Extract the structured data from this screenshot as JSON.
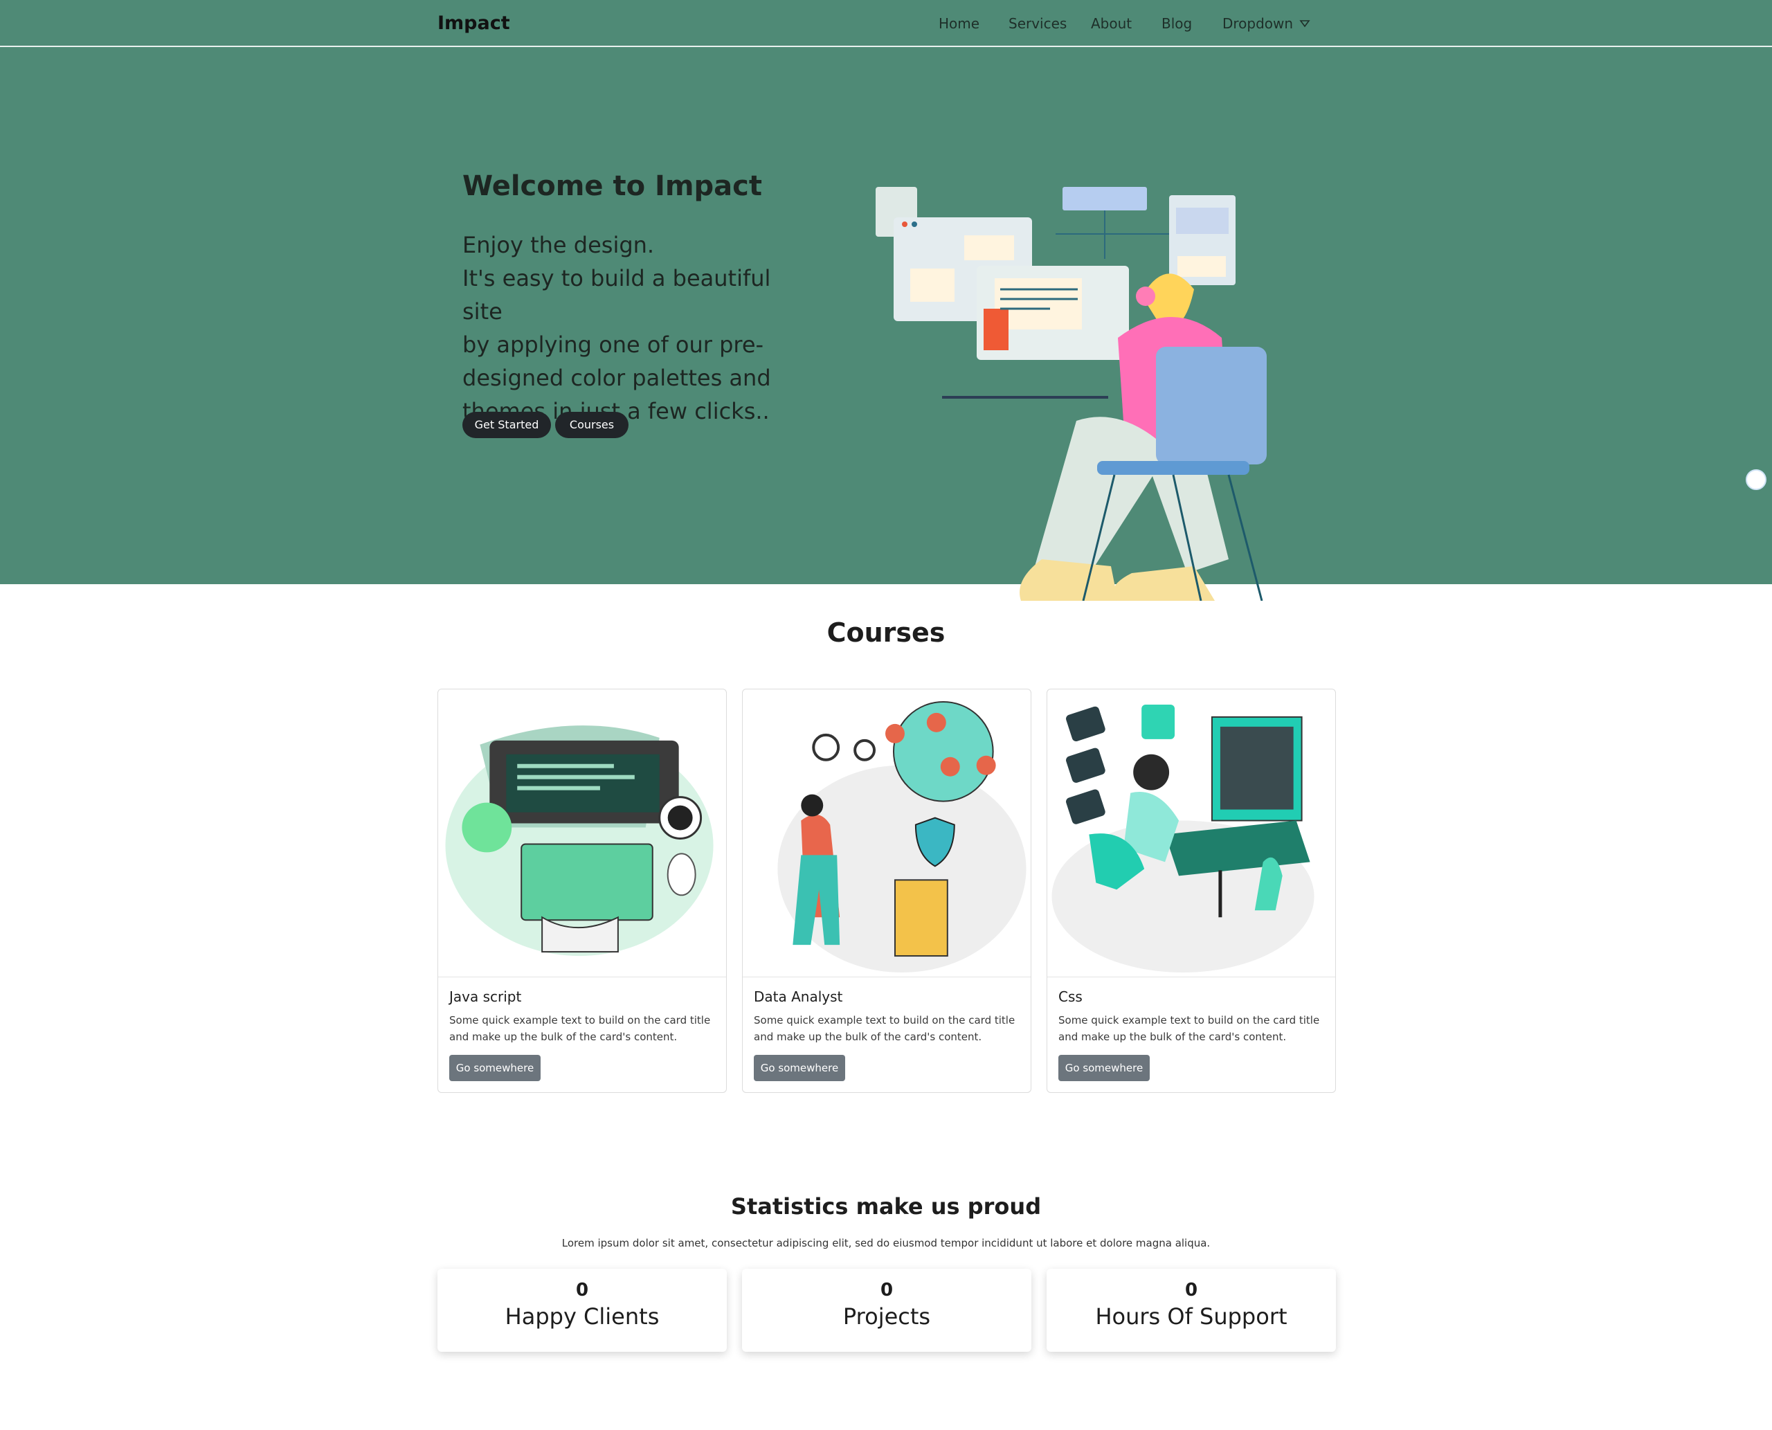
{
  "nav": {
    "brand": "Impact",
    "links": [
      "Home",
      "Services",
      "About",
      "Blog",
      "Dropdown"
    ]
  },
  "hero": {
    "title": "Welcome to Impact",
    "lines": [
      "Enjoy the design.",
      "It's easy to build a beautiful site",
      "by applying one of our pre-",
      "designed color palettes and",
      "themes in just a few clicks.."
    ],
    "btn_start": "Get Started",
    "btn_courses": "Courses"
  },
  "courses": {
    "title": "Courses",
    "cards": [
      {
        "title": "Java script",
        "text": "Some quick example text to build on the card title and make up the bulk of the card's content.",
        "button": "Go somewhere"
      },
      {
        "title": "Data Analyst",
        "text": "Some quick example text to build on the card title and make up the bulk of the card's content.",
        "button": "Go somewhere"
      },
      {
        "title": "Css",
        "text": "Some quick example text to build on the card title and make up the bulk of the card's content.",
        "button": "Go somewhere"
      }
    ]
  },
  "stats": {
    "title": "Statistics make us proud",
    "subtitle": "Lorem ipsum dolor sit amet, consectetur adipiscing elit, sed do eiusmod tempor incididunt ut labore et dolore magna aliqua.",
    "items": [
      {
        "value": "0",
        "label": "Happy Clients"
      },
      {
        "value": "0",
        "label": "Projects"
      },
      {
        "value": "0",
        "label": "Hours Of Support"
      }
    ]
  },
  "icons": [
    "chevron-down-icon",
    "globe-icon"
  ],
  "colors": {
    "primary": "#4f8a76",
    "dark_button": "#212529",
    "gray_button": "#6c757d"
  }
}
